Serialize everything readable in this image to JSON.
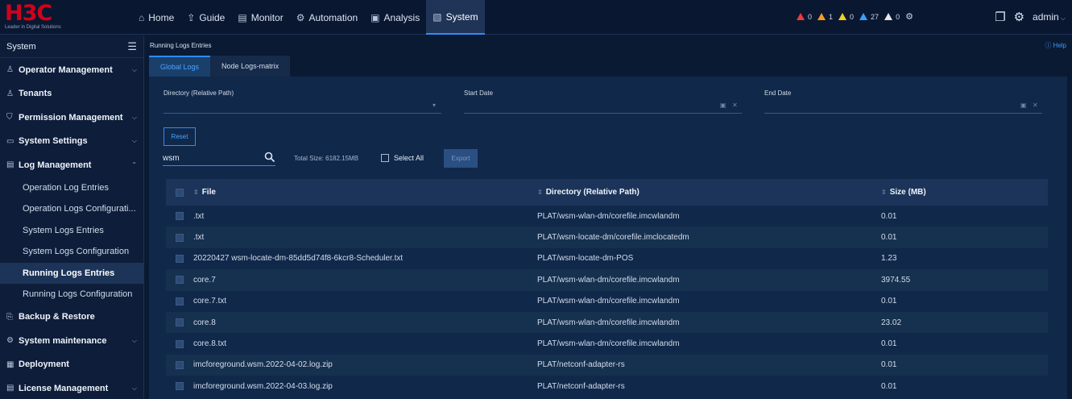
{
  "header": {
    "brand": "H3C",
    "slogan": "Leader in Digital Solutions",
    "nav": [
      {
        "label": "Home",
        "icon": "home-icon",
        "glyph": "⌂"
      },
      {
        "label": "Guide",
        "icon": "guide-icon",
        "glyph": "⇪"
      },
      {
        "label": "Monitor",
        "icon": "monitor-icon",
        "glyph": "▤"
      },
      {
        "label": "Automation",
        "icon": "automation-icon",
        "glyph": "⚙"
      },
      {
        "label": "Analysis",
        "icon": "analysis-icon",
        "glyph": "▣"
      },
      {
        "label": "System",
        "icon": "system-icon",
        "glyph": "▧",
        "active": true
      }
    ],
    "alarms": {
      "critical": "0",
      "major": "1",
      "minor": "0",
      "warning": "27",
      "info": "0"
    },
    "user": "admin"
  },
  "sidebar": {
    "title": "System",
    "groups": {
      "operator": "Operator Management",
      "tenants": "Tenants",
      "permission": "Permission Management",
      "settings": "System Settings",
      "log": "Log Management",
      "backup": "Backup & Restore",
      "maintenance": "System maintenance",
      "deployment": "Deployment",
      "license": "License Management"
    },
    "log_items": [
      "Operation Log Entries",
      "Operation Logs Configurati...",
      "System Logs Entries",
      "System Logs Configuration",
      "Running Logs Entries",
      "Running Logs Configuration"
    ]
  },
  "content": {
    "breadcrumb": "Running Logs Entries",
    "help": "Help",
    "tabs": [
      "Global Logs",
      "Node Logs-matrix"
    ],
    "filters": {
      "directory_label": "Directory (Relative Path)",
      "start_label": "Start Date",
      "end_label": "End Date"
    },
    "reset": "Reset",
    "search_value": "wsm",
    "total_size": "Total Size: 6182.15MB",
    "select_all": "Select All",
    "export": "Export",
    "table": {
      "columns": [
        "File",
        "Directory (Relative Path)",
        "Size (MB)"
      ],
      "rows": [
        [
          ".txt",
          "PLAT/wsm-wlan-dm/corefile.imcwlandm",
          "0.01"
        ],
        [
          ".txt",
          "PLAT/wsm-locate-dm/corefile.imclocatedm",
          "0.01"
        ],
        [
          "20220427 wsm-locate-dm-85dd5d74f8-6kcr8-Scheduler.txt",
          "PLAT/wsm-locate-dm-POS",
          "1.23"
        ],
        [
          "core.7",
          "PLAT/wsm-wlan-dm/corefile.imcwlandm",
          "3974.55"
        ],
        [
          "core.7.txt",
          "PLAT/wsm-wlan-dm/corefile.imcwlandm",
          "0.01"
        ],
        [
          "core.8",
          "PLAT/wsm-wlan-dm/corefile.imcwlandm",
          "23.02"
        ],
        [
          "core.8.txt",
          "PLAT/wsm-wlan-dm/corefile.imcwlandm",
          "0.01"
        ],
        [
          "imcforeground.wsm.2022-04-02.log.zip",
          "PLAT/netconf-adapter-rs",
          "0.01"
        ],
        [
          "imcforeground.wsm.2022-04-03.log.zip",
          "PLAT/netconf-adapter-rs",
          "0.01"
        ]
      ]
    }
  }
}
